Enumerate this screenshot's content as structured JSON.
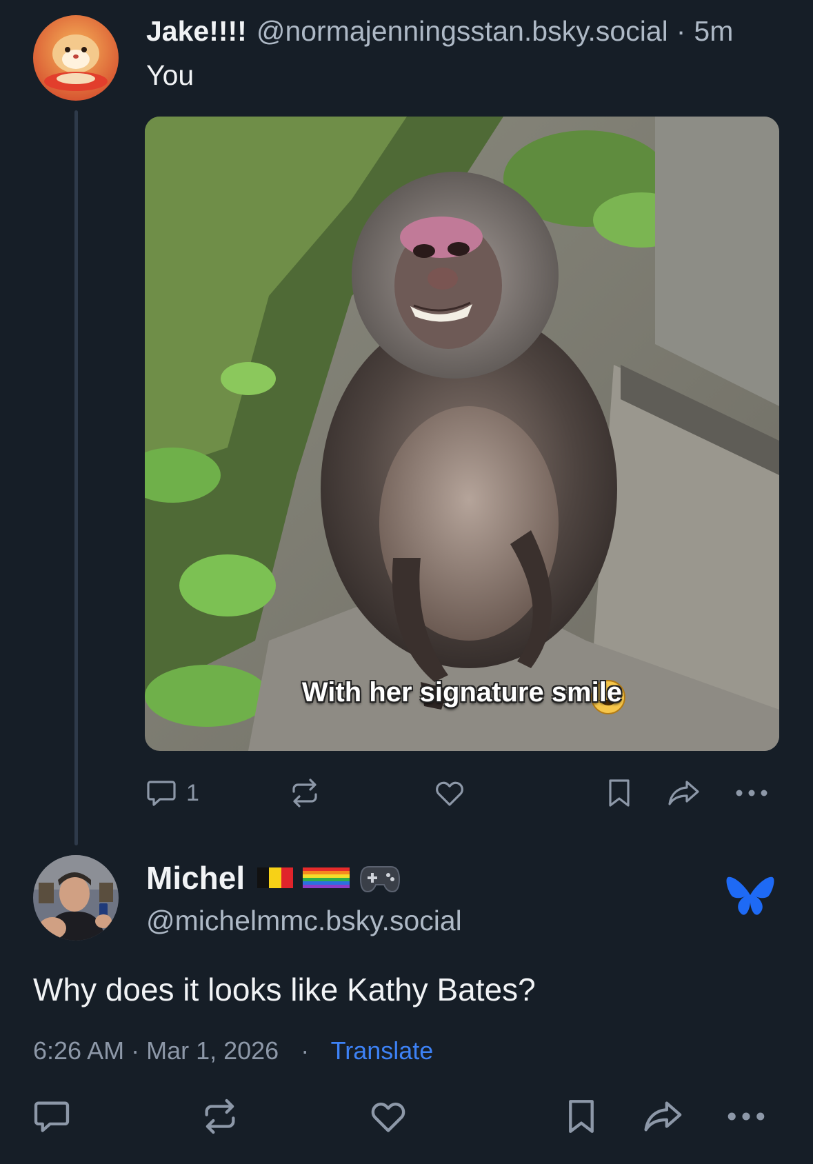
{
  "post": {
    "author_name": "Jake!!!!",
    "author_handle": "@normajenningsstan.bsky.social",
    "separator": "·",
    "time_ago": "5m",
    "text": "You",
    "image_caption": "With her signature smile",
    "image_caption_emoji": "😀",
    "reply_count": "1"
  },
  "reply": {
    "author_name": "Michel",
    "badges": [
      "belgium-flag",
      "rainbow-flag",
      "game-controller"
    ],
    "author_handle": "@michelmmc.bsky.social",
    "text": "Why does it looks like Kathy Bates?",
    "timestamp": "6:26 AM · Mar 1, 2026",
    "dot": "·",
    "translate_label": "Translate"
  },
  "colors": {
    "background": "#161e27",
    "muted": "#8d98a8",
    "accent": "#3d82f6",
    "thread_line": "#2e3a4a"
  }
}
